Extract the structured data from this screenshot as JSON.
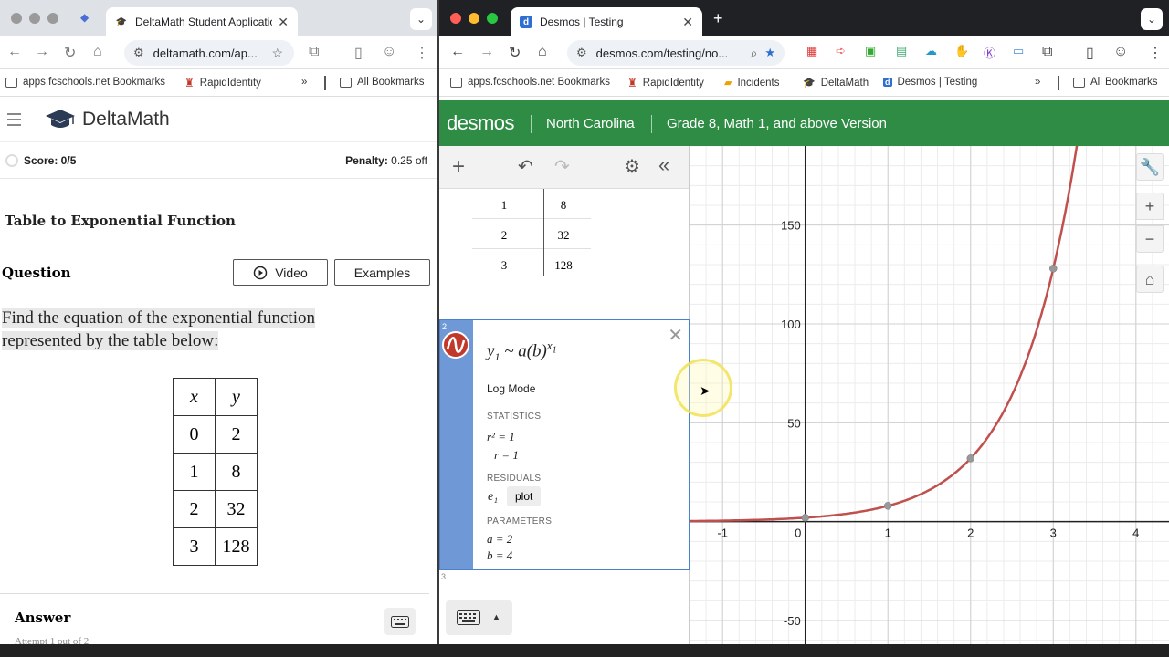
{
  "left_browser": {
    "tab_title": "DeltaMath Student Applicatio",
    "url": "deltamath.com/ap...",
    "bookmarks": [
      "apps.fcschools.net Bookmarks",
      "RapidIdentity",
      "All Bookmarks"
    ]
  },
  "right_browser": {
    "tab_title": "Desmos | Testing",
    "url": "desmos.com/testing/no...",
    "bookmarks": [
      "apps.fcschools.net Bookmarks",
      "RapidIdentity",
      "Incidents",
      "DeltaMath",
      "Desmos | Testing",
      "All Bookmarks"
    ]
  },
  "deltamath": {
    "logo": "DeltaMath",
    "score": "Score: 0/5",
    "penalty_label": "Penalty:",
    "penalty_value": "0.25 off",
    "title": "Table to Exponential Function",
    "question_label": "Question",
    "video_button": "Video",
    "examples_button": "Examples",
    "prompt_line1": "Find the equation of the exponential function",
    "prompt_line2": "represented by the table below:",
    "table": {
      "headers": [
        "x",
        "y"
      ],
      "rows": [
        [
          "0",
          "2"
        ],
        [
          "1",
          "8"
        ],
        [
          "2",
          "32"
        ],
        [
          "3",
          "128"
        ]
      ]
    },
    "answer_label": "Answer",
    "attempt_text": "Attempt 1 out of 2"
  },
  "desmos": {
    "logo": "desmos",
    "region": "North Carolina",
    "version": "Grade 8, Math 1, and above Version",
    "table_rows": [
      [
        "1",
        "8"
      ],
      [
        "2",
        "32"
      ],
      [
        "3",
        "128"
      ]
    ],
    "expression2": {
      "number": "2",
      "log_mode": "Log Mode",
      "statistics_label": "STATISTICS",
      "r2": "r² = 1",
      "r": "r = 1",
      "residuals_label": "RESIDUALS",
      "residual_var": "e₁",
      "plot_button": "plot",
      "parameters_label": "PARAMETERS",
      "a": "a = 2",
      "b": "b = 4"
    },
    "expression3_number": "3",
    "graph": {
      "x_ticks": [
        "-1",
        "0",
        "1",
        "2",
        "3",
        "4"
      ],
      "y_ticks": [
        "150",
        "100",
        "50",
        "-50"
      ]
    }
  },
  "chart_data": {
    "type": "scatter",
    "title": "",
    "xlabel": "",
    "ylabel": "",
    "points": [
      [
        0,
        2
      ],
      [
        1,
        8
      ],
      [
        2,
        32
      ],
      [
        3,
        128
      ]
    ],
    "curve": "y = 2·4^x",
    "xlim": [
      -1.4,
      4.4
    ],
    "ylim": [
      -62,
      190
    ],
    "grid": true,
    "colors": {
      "curve": "#c0504d",
      "points": "#999999",
      "header": "#2f8c44"
    }
  }
}
